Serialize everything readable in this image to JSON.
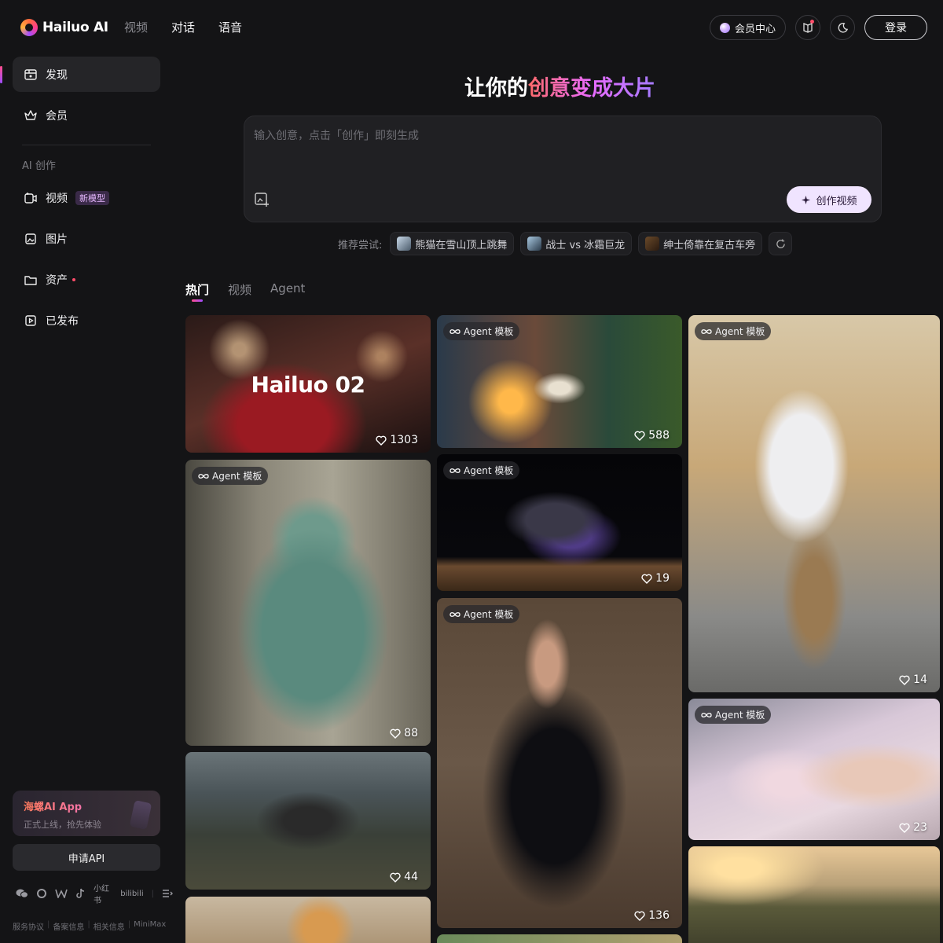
{
  "header": {
    "logo_text": "Hailuo AI",
    "nav": [
      "视频",
      "对话",
      "语音"
    ],
    "member_center": "会员中心",
    "login": "登录"
  },
  "sidebar": {
    "items": [
      {
        "label": "发现",
        "icon": "discover-icon"
      },
      {
        "label": "会员",
        "icon": "crown-icon"
      }
    ],
    "section_title": "AI 创作",
    "create_items": [
      {
        "label": "视频",
        "icon": "video-icon",
        "badge": "新模型"
      },
      {
        "label": "图片",
        "icon": "image-icon"
      },
      {
        "label": "资产",
        "icon": "folder-icon"
      },
      {
        "label": "已发布",
        "icon": "published-icon"
      }
    ],
    "app_card": {
      "title": "海螺AI App",
      "subtitle": "正式上线，抢先体验"
    },
    "api_button": "申请API",
    "social": [
      "小红书",
      "bilibili"
    ],
    "footer_links": [
      "服务协议",
      "备案信息",
      "相关信息",
      "MiniMax"
    ]
  },
  "hero": {
    "title_plain": "让你的",
    "title_grad": "创意变成大片"
  },
  "prompt": {
    "placeholder": "输入创意，点击「创作」即刻生成",
    "create_button": "创作视频"
  },
  "suggest": {
    "label": "推荐尝试:",
    "chips": [
      "熊猫在雪山顶上跳舞",
      "战士 vs 冰霜巨龙",
      "绅士倚靠在复古车旁"
    ]
  },
  "tabs": [
    "热门",
    "视频",
    "Agent"
  ],
  "cards": [
    {
      "title": "Hailuo 02",
      "likes": "1303",
      "tag": ""
    },
    {
      "tag": "Agent 模板",
      "likes": "588"
    },
    {
      "tag": "Agent 模板",
      "likes": "14"
    },
    {
      "tag": "Agent 模板",
      "likes": "88"
    },
    {
      "tag": "Agent 模板",
      "likes": "19"
    },
    {
      "tag": "Agent 模板",
      "likes": "136"
    },
    {
      "tag": "Agent 模板",
      "likes": "23"
    },
    {
      "tag": "",
      "likes": "44"
    }
  ],
  "colors": {
    "accent_start": "#ff4d8b",
    "accent_end": "#a04dff",
    "background": "#141416"
  }
}
